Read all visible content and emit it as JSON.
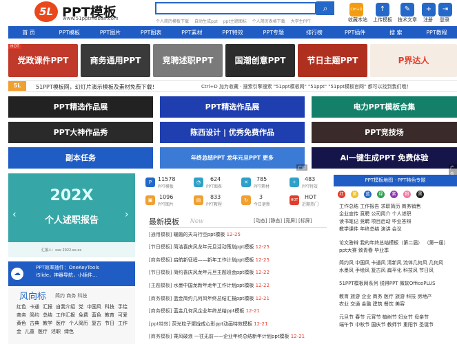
{
  "brand": {
    "logo_mark": "5L",
    "name": "PPT模板",
    "url": "www.51pptmoban.com"
  },
  "search": {
    "placeholder": "",
    "hot_words": [
      "个人简历模板下载",
      "自动生成ppt",
      "ppt主题图标",
      "个人简历表格下载",
      "大学生PPT"
    ]
  },
  "header_links": [
    {
      "label": "收藏本站",
      "color": "#f39c12",
      "icon": "Ctrl+D"
    },
    {
      "label": "上传模板",
      "color": "#2468c8",
      "icon": "↑"
    },
    {
      "label": "技术文章",
      "color": "#2468c8",
      "icon": "✎"
    },
    {
      "label": "注册",
      "color": "#2468c8",
      "icon": "+"
    },
    {
      "label": "登录",
      "color": "#2468c8",
      "icon": "⇥"
    }
  ],
  "nav": [
    "首 页",
    "PPT模板",
    "PPT图片",
    "PPT图表",
    "PPT素材",
    "PPT特效",
    "PPT专题",
    "排行榜",
    "PPT插件",
    "搜 索",
    "PPT教程"
  ],
  "hot_tag": "HOT",
  "banners": [
    {
      "label": "党政课件PPT",
      "color": "#c0392b"
    },
    {
      "label": "商务通用PPT",
      "color": "#3a3a3a"
    },
    {
      "label": "竞聘述职PPT",
      "color": "#7a7a7a"
    },
    {
      "label": "国潮创意PPT",
      "color": "#2c2c2c"
    },
    {
      "label": "节日主题PPT",
      "color": "#b03020"
    },
    {
      "label": "P界达人",
      "color": "#f5ece4"
    }
  ],
  "notice": {
    "logo": "5L",
    "left": "51PPT模板网，幻灯片演示模板及素材免费下载!",
    "right": "Ctrl+D 加为收藏 · 搜索引擎搜索 \"51ppt模板网\" \"51ppt\" \"51ppt模板官网\" 都可以找到我们哦！"
  },
  "ads": [
    {
      "label": "PPT精选作品展",
      "color": "#222"
    },
    {
      "label": "PPT精选作品展",
      "color": "#1f3fb0"
    },
    {
      "label": "电力PPT模板合集",
      "color": "#14806a"
    },
    {
      "label": "PPT大神作品秀",
      "color": "#2a2a2a"
    },
    {
      "label": "陈西设计 | 优秀免费作品",
      "color": "#1f3fb0"
    },
    {
      "label": "PPT竞技场",
      "color": "#3a2a2a"
    },
    {
      "label": "副本任务",
      "color": "#1f5cc4"
    },
    {
      "label": "年终总结PPT  龙年元旦PPT  更多",
      "color": "#3b7bd6"
    },
    {
      "label": "Ai一键生成PPT  免费体验",
      "color": "#15154a"
    }
  ],
  "ad_tag": "广告",
  "slider": {
    "title": "202X",
    "subtitle": "个人述职报告",
    "foot": "汇报人：xxx    2022.xx.xx"
  },
  "tool": {
    "lines": [
      "PPT效率插件：OneKeyTools",
      "iSlide，神器导航，小插件..."
    ]
  },
  "styles": {
    "title": "风向标",
    "sub": "简约 商务 科技",
    "words": [
      "红色",
      "卡通",
      "汇报",
      "自我介绍",
      "党",
      "中国风",
      "科技",
      "手绘",
      "商务",
      "简约",
      "总结",
      "工作汇报",
      "免费",
      "蓝色",
      "教育",
      "可爱",
      "黄色",
      "古典",
      "教学",
      "医疗",
      "个人简历",
      "复古",
      "节日",
      "工作",
      "金",
      "儿童",
      "医疗",
      "述职",
      "绿色"
    ]
  },
  "stats": [
    {
      "num": "11578",
      "lab": "PPT模板",
      "color": "#2468c8"
    },
    {
      "num": "624",
      "lab": "PPT图表",
      "color": "#2fa1c8"
    },
    {
      "num": "785",
      "lab": "PPT素材",
      "color": "#2fa1c8"
    },
    {
      "num": "483",
      "lab": "PPT特效",
      "color": "#2fa1c8"
    },
    {
      "num": "1096",
      "lab": "PPT图片",
      "color": "#f0a030"
    },
    {
      "num": "833",
      "lab": "PPT教程",
      "color": "#f0a030"
    },
    {
      "num": "3",
      "lab": "今日更新",
      "color": "#f0a030"
    },
    {
      "num": "HOT",
      "lab": "近期热门",
      "color": "#e23d2a"
    }
  ],
  "latest": {
    "title": "最新模板",
    "new": "New",
    "tabs": "[动态] [静态] [竞屏] [标屏]",
    "rows": [
      {
        "cat": "[通用模板]",
        "text": "暖融的天马行空ppt模板",
        "date": "12-25"
      },
      {
        "cat": "[节日模板]",
        "text": "简洁喜庆风龙年元旦活动策划ppt模板",
        "date": "12-25"
      },
      {
        "cat": "[商务模板]",
        "text": "启航新征程——新年工作计划ppt模板",
        "date": "12-25"
      },
      {
        "cat": "[节日模板]",
        "text": "简约喜庆风龙年元旦主题班会ppt模板",
        "date": "12-22"
      },
      {
        "cat": "[主题模板]",
        "text": "水墨中国龙新年龙年工作计划ppt模板",
        "date": "12-22"
      },
      {
        "cat": "[商务模板]",
        "text": "蓝金简约几何风年终总结汇报ppt模板",
        "date": "12-21"
      },
      {
        "cat": "[商务模板]",
        "text": "蓝金几何风企业年终总结ppt模板",
        "date": "12-21"
      },
      {
        "cat": "[ppt特效]",
        "text": "荧光粒子聚拢成心形ppt动画特效模板",
        "date": "12-21"
      },
      {
        "cat": "[商务模板]",
        "text": "乘风破浪 一往无前——企业年终总结新年计划ppt模板",
        "date": "12-21"
      }
    ]
  },
  "right": {
    "head": "PPT模板地图 · PPT特色专题",
    "colors": [
      {
        "t": "红",
        "c": "#e23d2a"
      },
      {
        "t": "黄",
        "c": "#f0c030"
      },
      {
        "t": "蓝",
        "c": "#2468c8"
      },
      {
        "t": "绿",
        "c": "#2fa050"
      },
      {
        "t": "紫",
        "c": "#8a3ab0"
      },
      {
        "t": "粉",
        "c": "#f07aa0"
      },
      {
        "t": "黑",
        "c": "#222"
      }
    ],
    "rows": [
      "工作总结  工作报告  求职简历  商务销售",
      "企业宣传  竞聘  公司简介  个人述职",
      "读书笔记  竞聘  项目启动  毕业答辩",
      "教学课件  年终总结  演讲  会议",
      "",
      "论文答辩  我的年终总结模板（第二届）  （第一届）",
      "ppt大赛  致青春  毕业季",
      "",
      "简约风  中国风  卡通风  清新风  流体几何风  几何风",
      "水墨风  手绘风  复古风  扁平化  科技风  节日风",
      "",
      "51PPT模板网系列  锐得PPT  微软OfficePLUS",
      "",
      "教育  旅游  企业  商务  医疗  旅游  科技  房地产",
      "农业  交通  金融  建筑  餐饮  美容",
      "",
      "元旦节  春节  元宵节  植树节  妇女节  母亲节",
      "端午节  中秋节  国庆节  教师节  重阳节  圣诞节"
    ]
  }
}
